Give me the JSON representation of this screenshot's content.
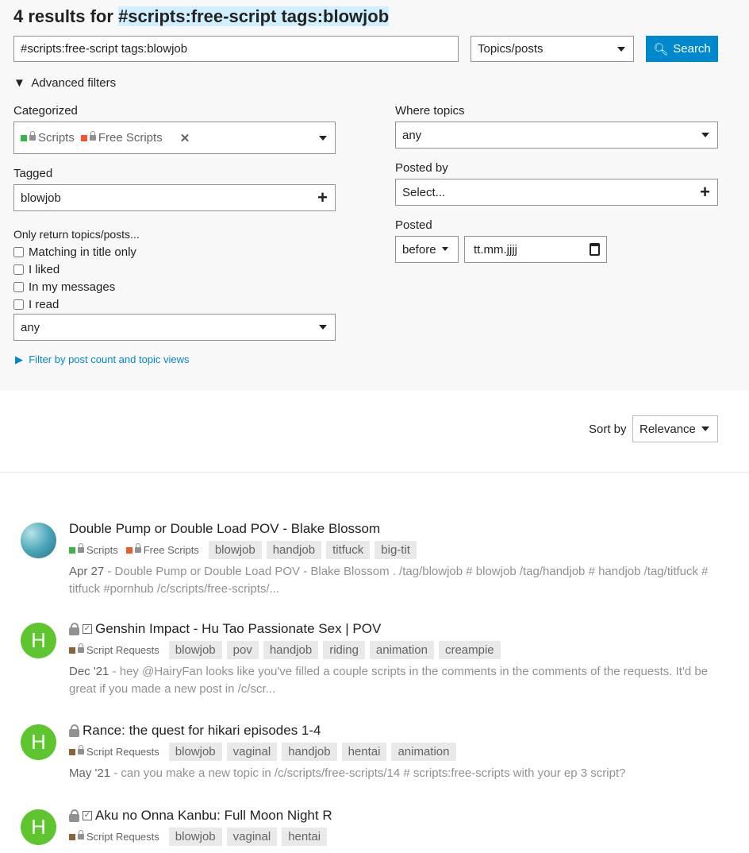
{
  "header": {
    "prefix": "4 results for",
    "query": "#scripts:free-script tags:blowjob"
  },
  "search": {
    "value": "#scripts:free-script tags:blowjob",
    "type_select": "Topics/posts",
    "button": "Search"
  },
  "advanced": {
    "toggle": "Advanced filters",
    "categorized_label": "Categorized",
    "categories": [
      {
        "name": "Scripts",
        "color": "#3ab54a"
      },
      {
        "name": "Free Scripts",
        "color": "#f1592a"
      }
    ],
    "tagged_label": "Tagged",
    "tagged_value": "blowjob",
    "only_return_label": "Only return topics/posts...",
    "checkboxes": [
      "Matching in title only",
      "I liked",
      "In my messages",
      "I read"
    ],
    "status_select": "any",
    "post_count_link": "Filter by post count and topic views",
    "where_topics_label": "Where topics",
    "where_topics_value": "any",
    "posted_by_label": "Posted by",
    "posted_by_placeholder": "Select...",
    "posted_label": "Posted",
    "posted_when": "before",
    "posted_date_placeholder": "tt.mm.jjjj"
  },
  "sort": {
    "label": "Sort by",
    "value": "Relevance"
  },
  "results": [
    {
      "title": "Double Pump or Double Load POV - Blake Blossom",
      "avatar": "",
      "categories": [
        {
          "name": "Scripts",
          "color": "#3ab54a"
        },
        {
          "name": "Free Scripts",
          "color": "#f1592a"
        }
      ],
      "tags": [
        "blowjob",
        "handjob",
        "titfuck",
        "big-tit"
      ],
      "date": "Apr 27",
      "blurb": "Double Pump or Double Load POV - Blake Blossom . /tag/blowjob # blowjob /tag/handjob # handjob /tag/titfuck # titfuck #pornhub /c/scripts/free-scripts/..."
    },
    {
      "title": "Genshin Impact - Hu Tao Passionate Sex | POV",
      "avatar": "H",
      "categories": [
        {
          "name": "Script Requests",
          "color": "#8c6238"
        }
      ],
      "tags": [
        "blowjob",
        "pov",
        "handjob",
        "riding",
        "animation",
        "creampie"
      ],
      "date": "Dec '21",
      "blurb": "hey @HairyFan looks like you've filled a couple scripts in the comments in the comments of the requests. It'd be great if you made a new post in /c/scr..."
    },
    {
      "title": "Rance: the quest for hikari episodes 1-4",
      "avatar": "H",
      "categories": [
        {
          "name": "Script Requests",
          "color": "#8c6238"
        }
      ],
      "tags": [
        "blowjob",
        "vaginal",
        "handjob",
        "hentai",
        "animation"
      ],
      "date": "May '21",
      "blurb": "can you make a new topic in /c/scripts/free-scripts/14 # scripts:free-scripts with your ep 3 script?"
    },
    {
      "title": "Aku no Onna Kanbu: Full Moon Night R",
      "avatar": "H",
      "categories": [
        {
          "name": "Script Requests",
          "color": "#8c6238"
        }
      ],
      "tags": [
        "blowjob",
        "vaginal",
        "hentai"
      ],
      "date": "",
      "blurb": ""
    }
  ]
}
